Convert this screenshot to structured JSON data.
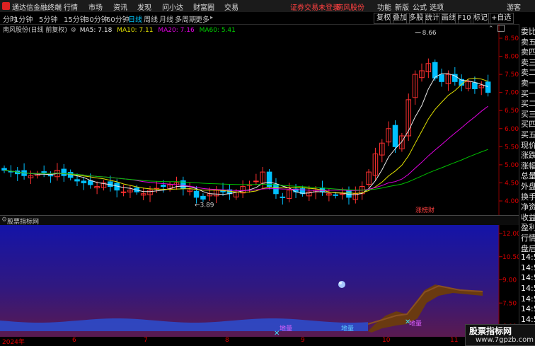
{
  "app": {
    "title": "通达信金融终端"
  },
  "menu": [
    "行情",
    "市场",
    "资讯",
    "发现",
    "问小达",
    "财富圈",
    "交易"
  ],
  "status": {
    "warning": "证券交易未登录",
    "stock": "南风股份"
  },
  "top_right": [
    "功能",
    "新版",
    "公式",
    "选项",
    "游客"
  ],
  "periods": [
    "分时",
    "1分钟",
    "5分钟",
    "15分钟",
    "30分钟",
    "60分钟",
    "日线",
    "周线",
    "月线",
    "多周期",
    "更多"
  ],
  "active_period": "日线",
  "right_buttons": [
    "复权",
    "叠加",
    "多股",
    "统计",
    "画线",
    "F10",
    "标记",
    "+自选"
  ],
  "chart_header": {
    "name": "南风股份(日线 前复权)",
    "ma5": "MA5: 7.18",
    "ma10": "MA10: 7.11",
    "ma20": "MA20: 7.16",
    "ma60": "MA60: 5.41"
  },
  "annotations": {
    "high": "8.66",
    "low": "3.89",
    "tag": "涨榜财"
  },
  "indicator": {
    "title": "股票指标网",
    "labels": [
      "地量",
      "地量",
      "地量"
    ],
    "y_ticks": [
      "12.00",
      "10.50",
      "9.00",
      "7.50",
      "6.00"
    ]
  },
  "price_ticks": [
    "8.50",
    "8.00",
    "7.50",
    "7.00",
    "6.50",
    "6.00",
    "5.50",
    "5.00",
    "4.50",
    "4.00"
  ],
  "dates": [
    "2024年",
    "6",
    "7",
    "8",
    "9",
    "10",
    "11"
  ],
  "right_panel": [
    "委比",
    "卖五",
    "卖四",
    "卖三",
    "卖二",
    "卖一",
    "买一",
    "买二",
    "买三",
    "买四",
    "买五",
    "现价",
    "涨跌",
    "涨幅",
    "总量",
    "外盘",
    "换手",
    "净资",
    "收益",
    "盈利",
    "行情",
    "盘后",
    "14:5",
    "14:5",
    "14:5",
    "14:5",
    "14:5",
    "14:5",
    "14:5",
    "14:5"
  ],
  "watermark": {
    "line1": "股票指标网",
    "line2": "www.7gpzb.com"
  },
  "chart_data": {
    "type": "candlestick",
    "title": "南风股份(日线 前复权)",
    "ylim": [
      3.7,
      8.9
    ],
    "y_ticks": [
      4.0,
      4.5,
      5.0,
      5.5,
      6.0,
      6.5,
      7.0,
      7.5,
      8.0,
      8.5
    ],
    "x_labels": [
      "2024年",
      "6",
      "7",
      "8",
      "9",
      "10",
      "11"
    ],
    "series": [
      {
        "name": "MA5",
        "last": 7.18
      },
      {
        "name": "MA10",
        "last": 7.11
      },
      {
        "name": "MA20",
        "last": 7.16
      },
      {
        "name": "MA60",
        "last": 5.41
      }
    ],
    "close_approx": [
      4.85,
      4.8,
      4.75,
      4.7,
      4.7,
      4.75,
      4.8,
      4.7,
      4.85,
      4.7,
      4.65,
      4.55,
      4.5,
      4.45,
      4.4,
      4.5,
      4.4,
      4.3,
      4.25,
      4.3,
      4.25,
      4.2,
      4.3,
      4.35,
      4.4,
      4.45,
      4.5,
      4.35,
      4.3,
      4.1,
      4.05,
      4.2,
      4.3,
      4.25,
      4.2,
      4.25,
      4.4,
      4.45,
      4.55,
      4.8,
      4.4,
      4.2,
      4.1,
      4.3,
      4.25,
      4.2,
      4.25,
      4.3,
      4.25,
      4.2,
      4.15,
      4.2,
      4.1,
      4.2,
      4.4,
      4.8,
      5.3,
      5.6,
      6.0,
      5.5,
      5.8,
      6.8,
      7.5,
      7.6,
      7.8,
      7.4,
      7.3,
      7.5,
      7.3,
      7.2,
      7.3,
      7.1,
      7.2,
      7.0
    ],
    "high_marker": 8.66,
    "low_marker": 3.89
  }
}
